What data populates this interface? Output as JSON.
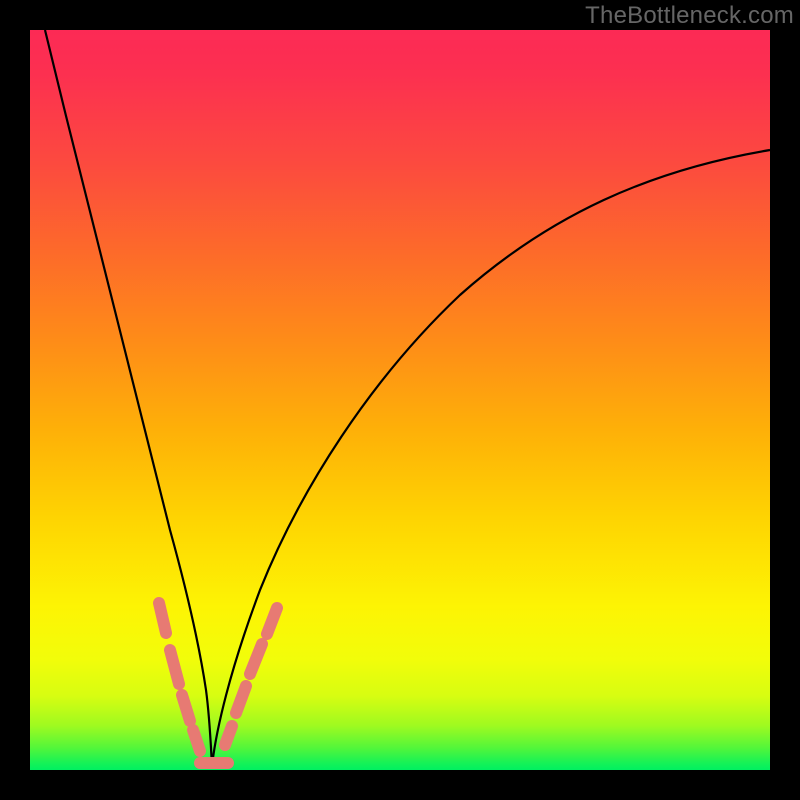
{
  "watermark": "TheBottleneck.com",
  "chart_data": {
    "type": "line",
    "title": "",
    "xlabel": "",
    "ylabel": "",
    "xlim": [
      0,
      100
    ],
    "ylim": [
      0,
      100
    ],
    "grid": false,
    "legend": false,
    "series": [
      {
        "name": "left-branch",
        "x": [
          2,
          6,
          10,
          14,
          17,
          19,
          20.5,
          22,
          23,
          23.8,
          24.5
        ],
        "y": [
          100,
          75,
          52,
          33,
          20,
          12,
          8,
          5,
          3,
          1.5,
          0.5
        ]
      },
      {
        "name": "right-branch",
        "x": [
          24.5,
          26,
          28,
          31,
          35,
          40,
          47,
          55,
          65,
          78,
          92,
          100
        ],
        "y": [
          0.5,
          3,
          8,
          15,
          25,
          36,
          48,
          58,
          67,
          75,
          81,
          83
        ]
      }
    ],
    "markers": [
      {
        "name": "left-dash-1",
        "x1": 17.4,
        "y1": 22.5,
        "x2": 18.4,
        "y2": 18.5
      },
      {
        "name": "left-dash-2",
        "x1": 19.0,
        "y1": 16.0,
        "x2": 20.2,
        "y2": 11.5
      },
      {
        "name": "left-dash-3",
        "x1": 20.6,
        "y1": 10.0,
        "x2": 21.6,
        "y2": 6.5
      },
      {
        "name": "left-dash-4",
        "x1": 22.1,
        "y1": 5.2,
        "x2": 23.0,
        "y2": 2.5
      },
      {
        "name": "bottom-dash",
        "x1": 23.0,
        "y1": 0.8,
        "x2": 26.7,
        "y2": 0.8
      },
      {
        "name": "right-dash-1",
        "x1": 26.3,
        "y1": 3.2,
        "x2": 27.3,
        "y2": 5.8
      },
      {
        "name": "right-dash-2",
        "x1": 27.9,
        "y1": 7.6,
        "x2": 29.2,
        "y2": 11.2
      },
      {
        "name": "right-dash-3",
        "x1": 29.8,
        "y1": 12.8,
        "x2": 31.4,
        "y2": 16.8
      },
      {
        "name": "right-dash-4",
        "x1": 32.0,
        "y1": 18.2,
        "x2": 33.4,
        "y2": 21.8
      }
    ],
    "gradient_stops": [
      {
        "pct": 0,
        "color": "#fc2a55"
      },
      {
        "pct": 50,
        "color": "#feb008"
      },
      {
        "pct": 80,
        "color": "#fdf404"
      },
      {
        "pct": 100,
        "color": "#00f061"
      }
    ]
  }
}
